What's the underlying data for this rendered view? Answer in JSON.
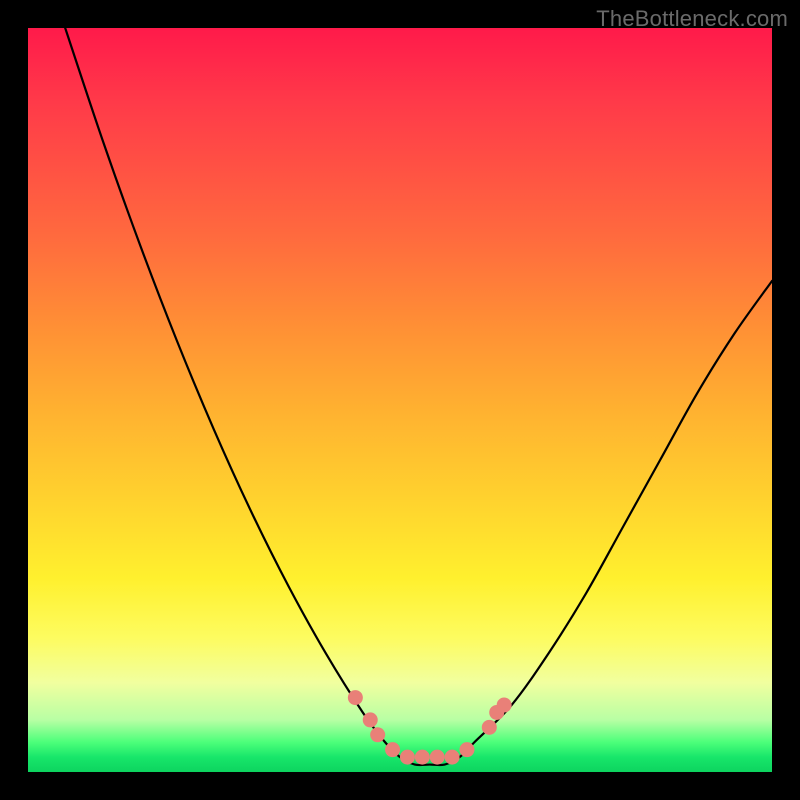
{
  "watermark": "TheBottleneck.com",
  "chart_data": {
    "type": "line",
    "title": "",
    "xlabel": "",
    "ylabel": "",
    "xlim": [
      0,
      100
    ],
    "ylim": [
      0,
      100
    ],
    "background_gradient_meaning": "green (low y) = good / low bottleneck, red (high y) = bad / high bottleneck",
    "series": [
      {
        "name": "bottleneck-curve",
        "x": [
          5,
          10,
          15,
          20,
          25,
          30,
          35,
          40,
          45,
          48,
          50,
          52,
          54,
          56,
          58,
          60,
          65,
          70,
          75,
          80,
          85,
          90,
          95,
          100
        ],
        "y": [
          100,
          85,
          71,
          58,
          46,
          35,
          25,
          16,
          8,
          4,
          2,
          1,
          1,
          1,
          2,
          4,
          9,
          16,
          24,
          33,
          42,
          51,
          59,
          66
        ]
      }
    ],
    "markers": {
      "name": "highlighted-points",
      "color": "#e98078",
      "points": [
        {
          "x": 44,
          "y": 10
        },
        {
          "x": 46,
          "y": 7
        },
        {
          "x": 47,
          "y": 5
        },
        {
          "x": 49,
          "y": 3
        },
        {
          "x": 51,
          "y": 2
        },
        {
          "x": 53,
          "y": 2
        },
        {
          "x": 55,
          "y": 2
        },
        {
          "x": 57,
          "y": 2
        },
        {
          "x": 59,
          "y": 3
        },
        {
          "x": 62,
          "y": 6
        },
        {
          "x": 63,
          "y": 8
        },
        {
          "x": 64,
          "y": 9
        }
      ]
    }
  }
}
